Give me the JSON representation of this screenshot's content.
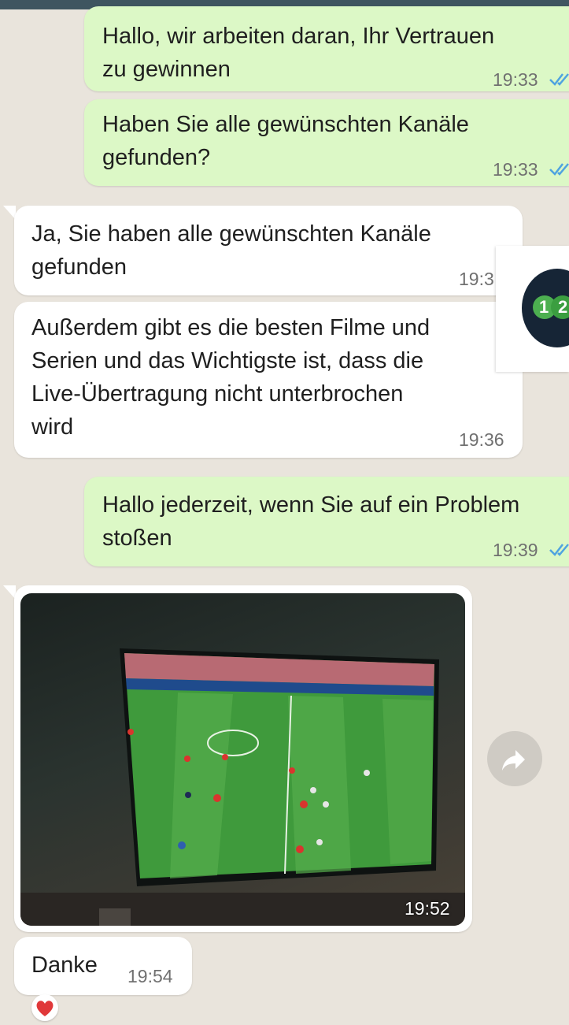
{
  "colors": {
    "outgoing_bubble": "#dcf8c6",
    "incoming_bubble": "#ffffff",
    "chat_background": "#e9e4dc",
    "read_ticks": "#4fa3e0"
  },
  "messages": [
    {
      "direction": "outgoing",
      "text": "Hallo, wir arbeiten daran, Ihr Vertrauen\nzu gewinnen",
      "time": "19:33",
      "status": "read"
    },
    {
      "direction": "outgoing",
      "text": "Haben Sie alle gewünschten Kanäle\ngefunden?",
      "time": "19:33",
      "status": "read"
    },
    {
      "direction": "incoming",
      "text": "Ja, Sie haben alle gewünschten Kanäle\ngefunden",
      "time": "19:3"
    },
    {
      "direction": "incoming",
      "text": "Außerdem gibt es die besten Filme und\nSerien und das Wichtigste ist, dass die\nLive-Übertragung nicht unterbrochen\nwird",
      "time": "19:36"
    },
    {
      "direction": "outgoing",
      "text": "Hallo jederzeit, wenn Sie auf ein Problem\nstoßen",
      "time": "19:39",
      "status": "read"
    },
    {
      "direction": "incoming",
      "type": "image",
      "image_description_icon": "tv-football-photo",
      "time": "19:52"
    },
    {
      "direction": "incoming",
      "text": "Danke",
      "time": "19:54",
      "reaction_icon": "heart-icon"
    }
  ],
  "overlay": {
    "chat_head_icon": "floating-chat-head-icon",
    "chat_head_digits": [
      "1",
      "2"
    ],
    "forward_icon": "forward-arrow-icon"
  }
}
